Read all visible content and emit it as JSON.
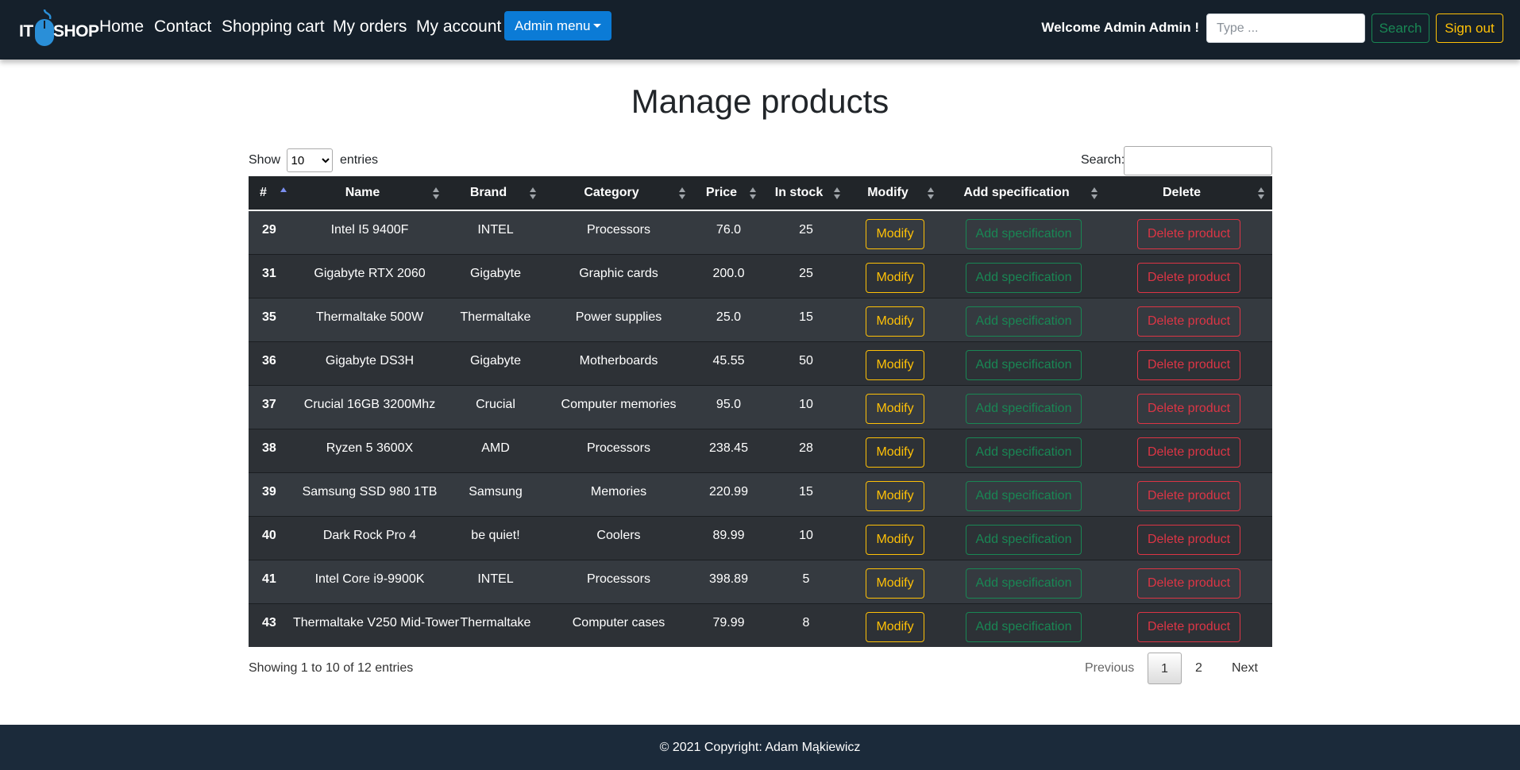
{
  "navbar": {
    "logo_left": "IT",
    "logo_right": "SHOP",
    "links": [
      "Home",
      "Contact",
      "Shopping cart",
      "My orders",
      "My account"
    ],
    "admin_menu": "Admin menu",
    "welcome": "Welcome Admin Admin !",
    "search_placeholder": "Type ...",
    "search_button": "Search",
    "signout_button": "Sign out"
  },
  "page_title": "Manage products",
  "table_controls": {
    "show_label": "Show",
    "entries_label": "entries",
    "page_length": "10",
    "search_label": "Search:"
  },
  "table": {
    "columns": [
      "#",
      "Name",
      "Brand",
      "Category",
      "Price",
      "In stock",
      "Modify",
      "Add specification",
      "Delete"
    ],
    "rows": [
      {
        "id": "29",
        "name": "Intel I5 9400F",
        "brand": "INTEL",
        "category": "Processors",
        "price": "76.0",
        "stock": "25"
      },
      {
        "id": "31",
        "name": "Gigabyte RTX 2060",
        "brand": "Gigabyte",
        "category": "Graphic cards",
        "price": "200.0",
        "stock": "25"
      },
      {
        "id": "35",
        "name": "Thermaltake 500W",
        "brand": "Thermaltake",
        "category": "Power supplies",
        "price": "25.0",
        "stock": "15"
      },
      {
        "id": "36",
        "name": "Gigabyte DS3H",
        "brand": "Gigabyte",
        "category": "Motherboards",
        "price": "45.55",
        "stock": "50"
      },
      {
        "id": "37",
        "name": "Crucial 16GB 3200Mhz",
        "brand": "Crucial",
        "category": "Computer memories",
        "price": "95.0",
        "stock": "10"
      },
      {
        "id": "38",
        "name": "Ryzen 5 3600X",
        "brand": "AMD",
        "category": "Processors",
        "price": "238.45",
        "stock": "28"
      },
      {
        "id": "39",
        "name": "Samsung SSD 980 1TB",
        "brand": "Samsung",
        "category": "Memories",
        "price": "220.99",
        "stock": "15"
      },
      {
        "id": "40",
        "name": "Dark Rock Pro 4",
        "brand": "be quiet!",
        "category": "Coolers",
        "price": "89.99",
        "stock": "10"
      },
      {
        "id": "41",
        "name": "Intel Core i9-9900K",
        "brand": "INTEL",
        "category": "Processors",
        "price": "398.89",
        "stock": "5"
      },
      {
        "id": "43",
        "name": "Thermaltake V250 Mid-Tower",
        "brand": "Thermaltake",
        "category": "Computer cases",
        "price": "79.99",
        "stock": "8"
      }
    ],
    "modify_label": "Modify",
    "add_spec_label": "Add specification",
    "delete_label": "Delete product"
  },
  "pagination": {
    "info": "Showing 1 to 10 of 12 entries",
    "previous": "Previous",
    "pages": [
      "1",
      "2"
    ],
    "next": "Next"
  },
  "footer": "© 2021 Copyright: Adam Mąkiewicz",
  "colors": {
    "navbar_bg": "#15202b",
    "admin_button": "#0b7bd6",
    "success": "#198754",
    "warning": "#ffc107",
    "danger": "#dc3545",
    "table_header": "#212529"
  },
  "icons": [
    "mouse-logo-icon",
    "dropdown-caret-icon",
    "sort-icon",
    "sort-asc-icon"
  ]
}
